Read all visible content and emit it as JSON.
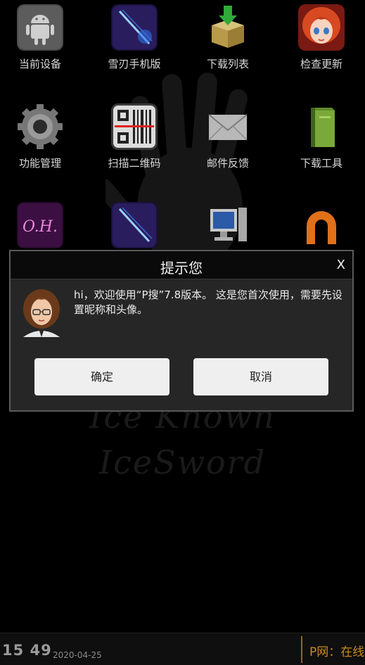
{
  "background": {
    "watermark_line1": "Ice Known",
    "watermark_line2": "IceSword"
  },
  "launcher": {
    "items": [
      {
        "label": "当前设备",
        "icon": "android-icon"
      },
      {
        "label": "雪刃手机版",
        "icon": "blade-icon"
      },
      {
        "label": "下载列表",
        "icon": "download-box-icon"
      },
      {
        "label": "检查更新",
        "icon": "anime-girl-icon"
      },
      {
        "label": "功能管理",
        "icon": "gear-icon"
      },
      {
        "label": "扫描二维码",
        "icon": "qr-scan-icon"
      },
      {
        "label": "邮件反馈",
        "icon": "mail-icon"
      },
      {
        "label": "下载工具",
        "icon": "green-book-icon"
      },
      {
        "label": "",
        "icon": "oh-logo-icon"
      },
      {
        "label": "",
        "icon": "blade-icon"
      },
      {
        "label": "",
        "icon": "computer-icon"
      },
      {
        "label": "",
        "icon": "magnet-icon"
      }
    ]
  },
  "dialog": {
    "title": "提示您",
    "close_label": "X",
    "message": "hi，欢迎使用“P搜”7.8版本。 这是您首次使用，需要先设置昵称和头像。",
    "ok_label": "确定",
    "cancel_label": "取消"
  },
  "statusbar": {
    "time": "15 49",
    "date": "2020-04-25",
    "ticker": "P网：在线"
  },
  "colors": {
    "background": "#000000",
    "dialog_bg": "#262626",
    "button_bg": "#efefef",
    "ticker": "#c98a1a"
  }
}
